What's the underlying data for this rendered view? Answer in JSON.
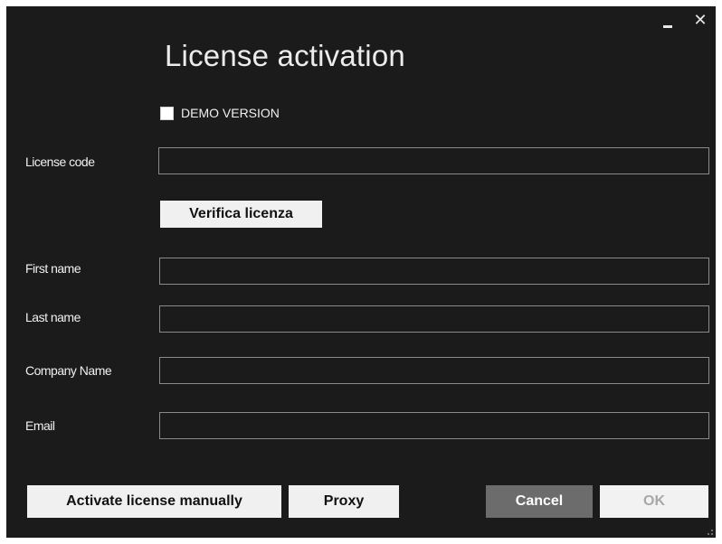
{
  "window": {
    "title": "License activation",
    "minimize_icon": "minimize-icon",
    "close_icon": "close-icon",
    "close_glyph": "✕"
  },
  "demo": {
    "label": "DEMO VERSION",
    "checked": false
  },
  "license": {
    "label": "License code",
    "value": "",
    "verify_button": "Verifica licenza"
  },
  "fields": {
    "first_name": {
      "label": "First name",
      "value": ""
    },
    "last_name": {
      "label": "Last name",
      "value": ""
    },
    "company": {
      "label": "Company Name",
      "value": ""
    },
    "email": {
      "label": "Email",
      "value": ""
    }
  },
  "buttons": {
    "activate_manually": "Activate license manually",
    "proxy": "Proxy",
    "cancel": "Cancel",
    "ok": "OK",
    "ok_enabled": false
  },
  "colors": {
    "background": "#1b1b1b",
    "text": "#f0f0f0",
    "field_border": "#8a8a8a",
    "button_light": "#f0f0f0",
    "button_cancel": "#6c6c6c",
    "button_disabled_text": "#a8a8a8"
  }
}
